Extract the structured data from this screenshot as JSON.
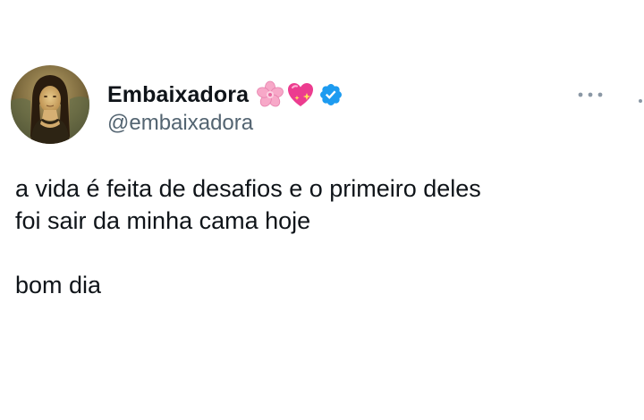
{
  "author": {
    "display_name": "Embaixadora",
    "handle": "@embaixadora",
    "name_emojis": [
      "cherry-blossom-icon",
      "sparkling-heart-icon"
    ],
    "verified": true
  },
  "tweet": {
    "lines": [
      "a vida é feita de desafios e o primeiro deles",
      "foi sair da minha cama hoje"
    ],
    "closing": "bom dia"
  },
  "colors": {
    "text": "#0f1419",
    "secondary_text": "#536471",
    "verified_badge": "#1d9bf0",
    "background": "#ffffff"
  }
}
